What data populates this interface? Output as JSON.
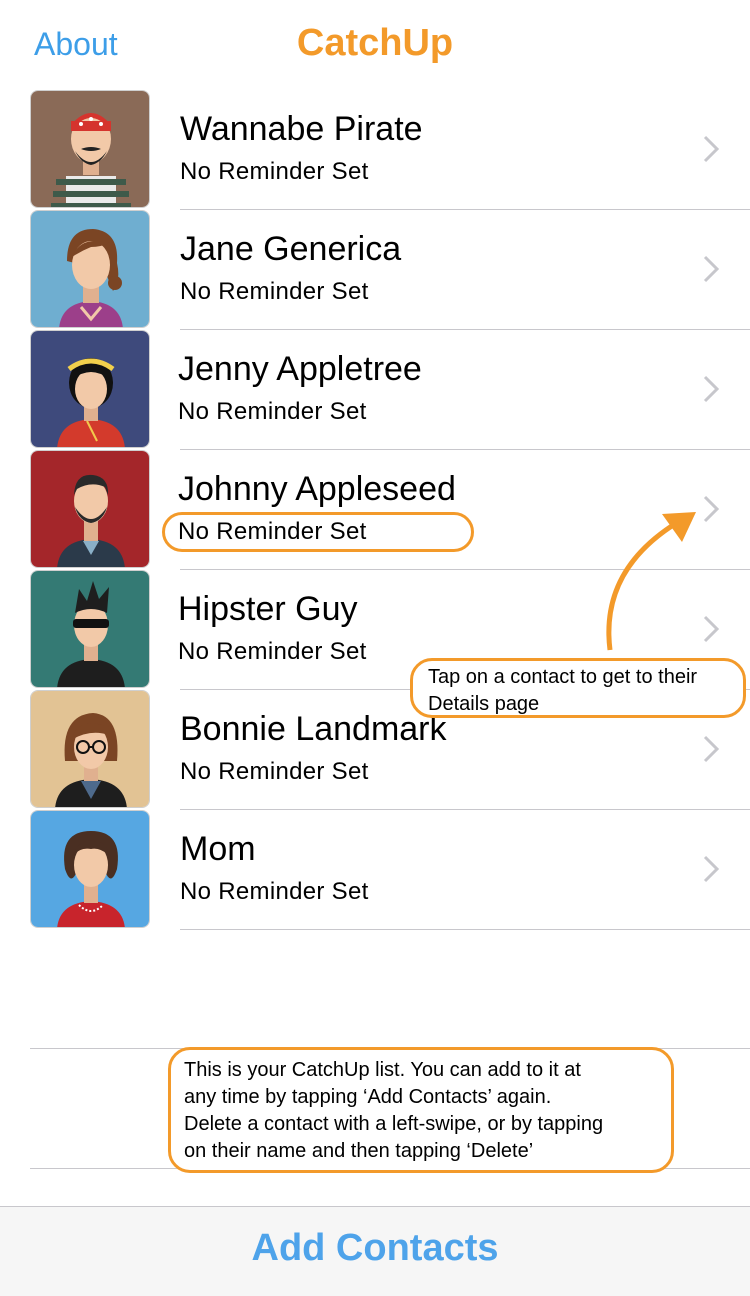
{
  "nav": {
    "about": "About",
    "title": "CatchUp"
  },
  "contacts": [
    {
      "name": "Wannabe Pirate",
      "status": "No Reminder Set",
      "avatar_bg": "#8a6a57",
      "avatar_icon": "pirate-avatar-icon"
    },
    {
      "name": "Jane Generica",
      "status": "No Reminder Set",
      "avatar_bg": "#6faed0",
      "avatar_icon": "woman-avatar-icon"
    },
    {
      "name": "Jenny Appletree",
      "status": "No Reminder Set",
      "avatar_bg": "#3e4a7c",
      "avatar_icon": "girl-headband-avatar-icon"
    },
    {
      "name": "Johnny Appleseed",
      "status": "No Reminder Set",
      "avatar_bg": "#a4262a",
      "avatar_icon": "bearded-man-avatar-icon"
    },
    {
      "name": "Hipster Guy",
      "status": "No Reminder Set",
      "avatar_bg": "#347a74",
      "avatar_icon": "hipster-avatar-icon"
    },
    {
      "name": "Bonnie Landmark",
      "status": "No Reminder Set",
      "avatar_bg": "#e2c394",
      "avatar_icon": "glasses-woman-avatar-icon"
    },
    {
      "name": "Mom",
      "status": "No Reminder Set",
      "avatar_bg": "#56a7e2",
      "avatar_icon": "mom-avatar-icon"
    }
  ],
  "callouts": {
    "tap_line1": "Tap on a contact to get to their",
    "tap_line2": "Details page",
    "list_line1": "This is your CatchUp list. You can add to it at",
    "list_line2": "any time by tapping ‘Add Contacts’ again.",
    "list_line3": "Delete a contact with a left-swipe, or by tapping",
    "list_line4": "on their name and then tapping ‘Delete’"
  },
  "bottom": {
    "add_contacts": "Add Contacts"
  },
  "colors": {
    "accent_orange": "#f39a2a",
    "link_blue": "#3d9ee8",
    "separator": "#c8c7cc"
  }
}
